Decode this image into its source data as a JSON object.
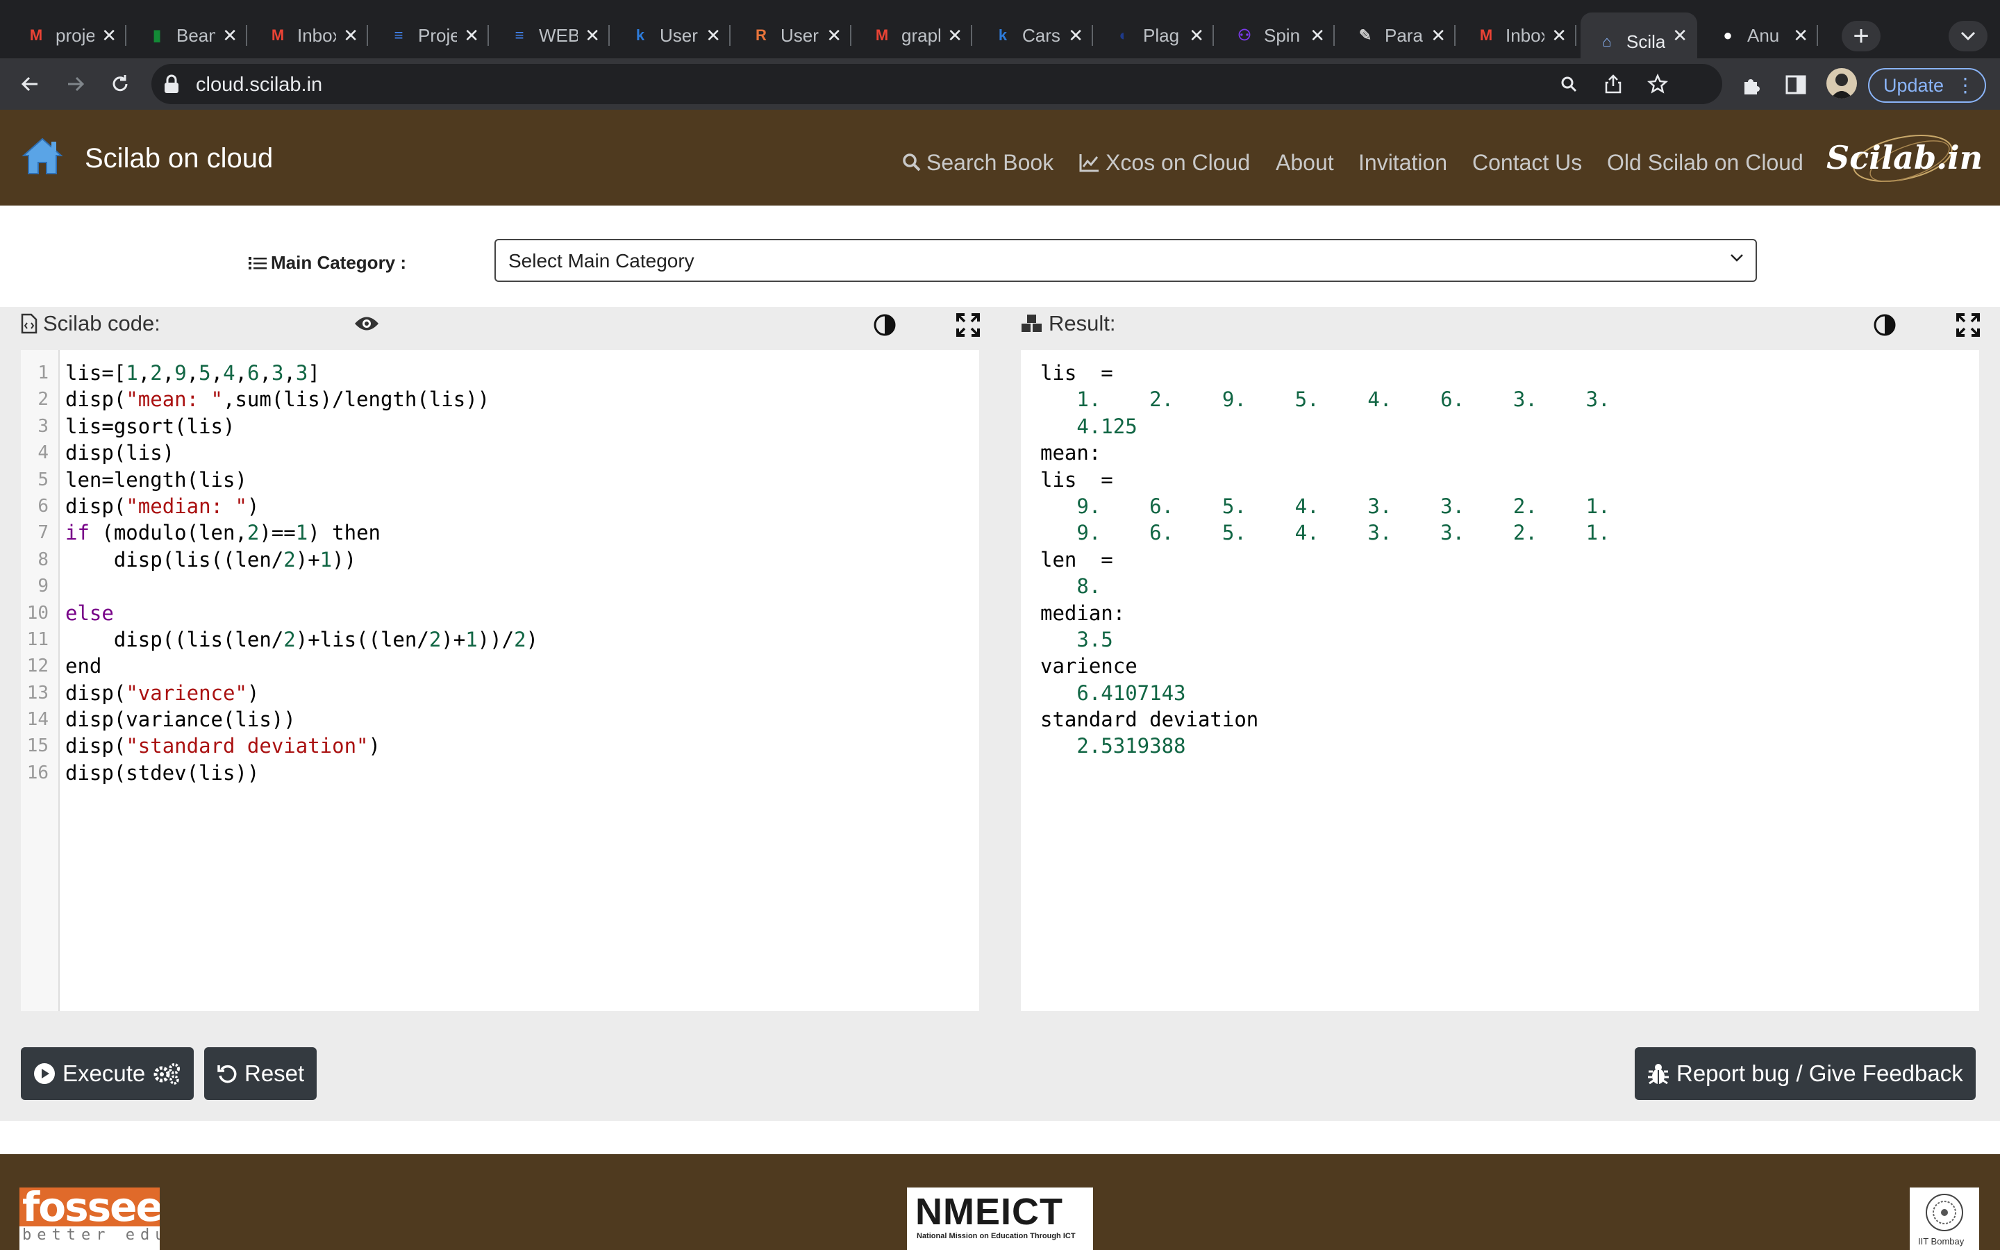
{
  "browser": {
    "tabs": [
      {
        "title": "project",
        "favicon": "gmail-icon",
        "color": "#ea4335"
      },
      {
        "title": "Beamer",
        "favicon": "overleaf-icon",
        "color": "#138a36"
      },
      {
        "title": "Inbox",
        "favicon": "gmail-icon",
        "color": "#ea4335"
      },
      {
        "title": "Project",
        "favicon": "docs-icon",
        "color": "#4285f4"
      },
      {
        "title": "WEB",
        "favicon": "docs-icon",
        "color": "#4285f4"
      },
      {
        "title": "User",
        "favicon": "k-icon",
        "color": "#2d7bd9"
      },
      {
        "title": "User",
        "favicon": "r-icon",
        "color": "#e8743b"
      },
      {
        "title": "graph",
        "favicon": "gmail-icon",
        "color": "#ea4335"
      },
      {
        "title": "Cars",
        "favicon": "k-icon",
        "color": "#2d7bd9"
      },
      {
        "title": "Plag",
        "favicon": "plag-icon",
        "color": "#1e3a8a"
      },
      {
        "title": "Spin",
        "favicon": "spin-icon",
        "color": "#7c3aed"
      },
      {
        "title": "Para",
        "favicon": "quill-icon",
        "color": "#cccccc"
      },
      {
        "title": "Inbox",
        "favicon": "gmail-icon",
        "color": "#ea4335"
      },
      {
        "title": "Scilab",
        "favicon": "home-icon",
        "color": "#8ab4f8"
      },
      {
        "title": "Anu",
        "favicon": "github-icon",
        "color": "#ffffff"
      }
    ],
    "active_tab_index": 13,
    "url": "cloud.scilab.in",
    "update_label": "Update"
  },
  "header": {
    "brand": "Scilab on cloud",
    "nav": [
      {
        "label": "Search Book",
        "icon": "search-icon"
      },
      {
        "label": "Xcos on Cloud",
        "icon": "chart-icon"
      },
      {
        "label": "About"
      },
      {
        "label": "Invitation"
      },
      {
        "label": "Contact Us"
      },
      {
        "label": "Old Scilab on Cloud"
      }
    ],
    "logo_text": "Scilab.in"
  },
  "category": {
    "label": "Main Category :",
    "selected": "Select Main Category"
  },
  "editor": {
    "title": "Scilab code:",
    "line_numbers": [
      "1",
      "2",
      "3",
      "4",
      "5",
      "6",
      "7",
      "8",
      "9",
      "10",
      "11",
      "12",
      "13",
      "14",
      "15",
      "16"
    ]
  },
  "result": {
    "title": "Result:",
    "lines": [
      {
        "text": "lis  =",
        "kind": "label"
      },
      {
        "text": "   1.    2.    9.    5.    4.    6.    3.    3.",
        "kind": "val"
      },
      {
        "text": "   4.125",
        "kind": "val"
      },
      {
        "text": "mean:",
        "kind": "label"
      },
      {
        "text": "lis  =",
        "kind": "label"
      },
      {
        "text": "   9.    6.    5.    4.    3.    3.    2.    1.",
        "kind": "val"
      },
      {
        "text": "   9.    6.    5.    4.    3.    3.    2.    1.",
        "kind": "val"
      },
      {
        "text": "len  =",
        "kind": "label"
      },
      {
        "text": "   8.",
        "kind": "val"
      },
      {
        "text": "median:",
        "kind": "label"
      },
      {
        "text": "   3.5",
        "kind": "val"
      },
      {
        "text": "varience",
        "kind": "label"
      },
      {
        "text": "   6.4107143",
        "kind": "val"
      },
      {
        "text": "standard deviation",
        "kind": "label"
      },
      {
        "text": "   2.5319388",
        "kind": "val"
      }
    ]
  },
  "buttons": {
    "execute": "Execute",
    "reset": "Reset",
    "feedback": "Report bug / Give Feedback"
  },
  "footer": {
    "logo1": "fossee",
    "logo1_sub": "better education",
    "logo2": "NMEICT",
    "logo2_sub": "National Mission on Education Through ICT",
    "logo3_sub": "IIT Bombay"
  }
}
